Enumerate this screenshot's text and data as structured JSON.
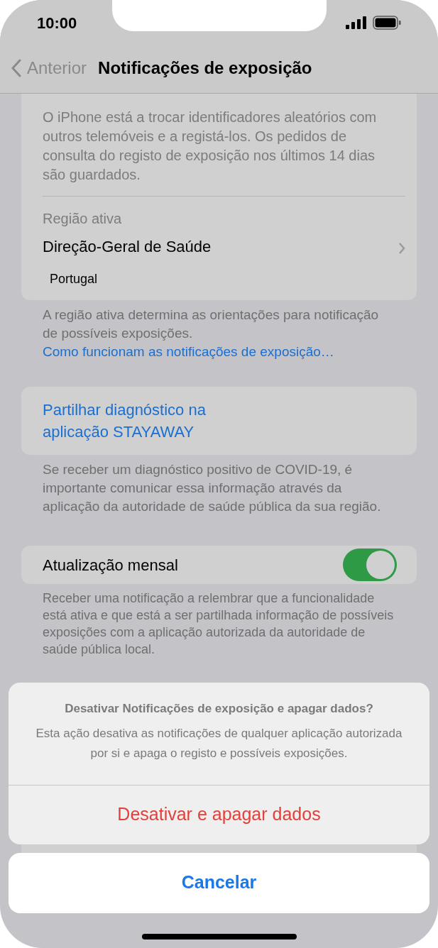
{
  "status_bar": {
    "time": "10:00"
  },
  "nav": {
    "back": "Anterior",
    "title": "Notificações de exposição"
  },
  "status_card": {
    "description": "O iPhone está a trocar identificadores aleatórios com outros telemóveis e a registá-los. Os pedidos de consulta do registo de exposição nos últimos 14 dias são guardados.",
    "region_label": "Região ativa",
    "region": "Direção-Geral de Saúde",
    "country": "Portugal"
  },
  "region_footer": {
    "text": "A região ativa determina as orientações para notificação de possíveis exposições.",
    "link": "Como funcionam as notificações de exposição…"
  },
  "share": {
    "label": "Partilhar diagnóstico na aplicação STAYAWAY",
    "footer": "Se receber um diagnóstico positivo de COVID-19, é importante comunicar essa informação através da aplicação da autoridade de saúde pública da sua região."
  },
  "monthly": {
    "label": "Atualização mensal",
    "on": true,
    "footer": "Receber uma notificação a relembrar que a funcionalidade está ativa e que está a ser partilhada informação de possíveis exposições com a aplicação autorizada da autoridade de saúde pública local."
  },
  "action_sheet": {
    "title": "Desativar Notificações de exposição e apagar dados?",
    "message": "Esta ação desativa as notificações de qualquer aplicação autorizada por si e apaga o registo e possíveis exposições.",
    "destructive": "Desativar e apagar dados",
    "cancel": "Cancelar"
  }
}
